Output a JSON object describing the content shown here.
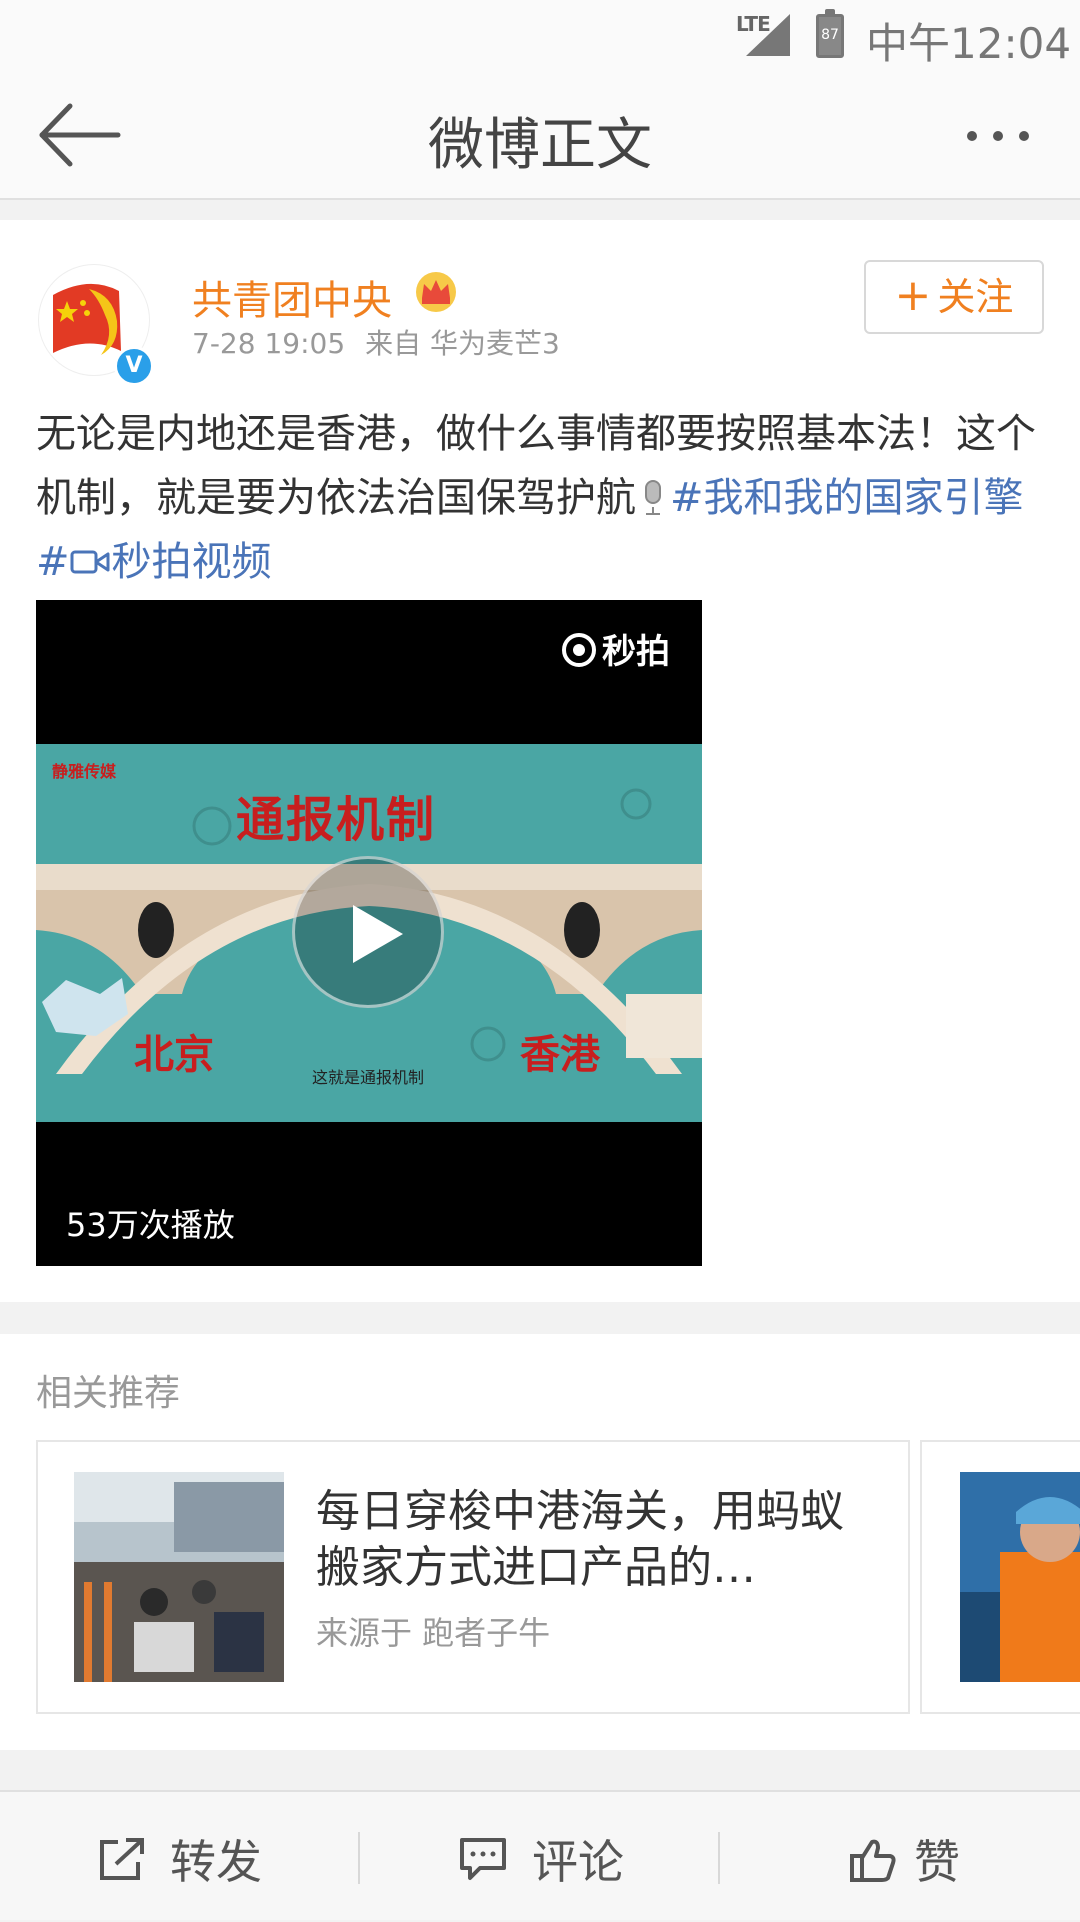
{
  "status_bar": {
    "network": "LTE",
    "battery": "87",
    "time": "中午12:04"
  },
  "nav": {
    "title": "微博正文"
  },
  "post": {
    "author": "共青团中央",
    "verified_mark": "V",
    "time": "7-28 19:05",
    "source": "来自 华为麦芒3",
    "follow_label": "关注",
    "text_part1": "无论是内地还是香港，做什么事情都要按照基本法！这个机制，就是要为依法治国保驾护航",
    "hashtag": "#我和我的国家引擎#",
    "link_text": "秒拍视频",
    "video": {
      "brand": "秒拍",
      "frame_title": "通报机制",
      "frame_logo": "静雅传媒",
      "frame_left": "北京",
      "frame_right": "香港",
      "frame_subtitle": "这就是通报机制",
      "play_count": "53万次播放"
    }
  },
  "related": {
    "title": "相关推荐",
    "items": [
      {
        "title": "每日穿梭中港海关，用蚂蚁搬家方式进口产品的…",
        "source": "来源于 跑者子牛"
      }
    ]
  },
  "toolbar": {
    "repost": "转发",
    "comment": "评论",
    "like": "赞"
  },
  "colors": {
    "accent": "#f08020",
    "link": "#4a74b8",
    "verified": "#2a9fe9"
  }
}
